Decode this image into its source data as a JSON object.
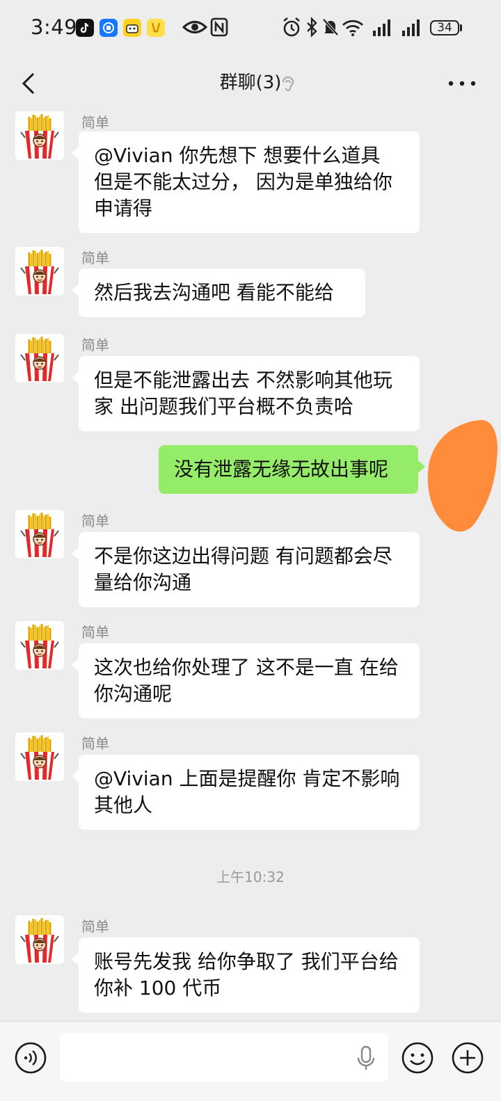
{
  "status_bar": {
    "time": "3:49",
    "battery": "34",
    "icons": [
      "tiktok-icon",
      "app-icon",
      "bilibili-icon",
      "app-icon",
      "eye-icon",
      "nfc-icon",
      "alarm-icon",
      "bluetooth-icon",
      "mute-icon",
      "wifi-icon",
      "signal-icon",
      "signal-icon",
      "battery-icon"
    ]
  },
  "header": {
    "title": "群聊(3)",
    "back_icon": "chevron-left-icon",
    "ear_icon": "ear-icon",
    "more_icon": "more-icon"
  },
  "messages": [
    {
      "sender": "简单",
      "text": "@Vivian  你先想下  想要什么道具 但是不能太过分，   因为是单独给你申请得",
      "direction": "in"
    },
    {
      "sender": "简单",
      "text": "然后我去沟通吧 看能不能给",
      "direction": "in"
    },
    {
      "sender": "简单",
      "text": "但是不能泄露出去  不然影响其他玩家  出问题我们平台概不负责哈",
      "direction": "in"
    },
    {
      "sender": "",
      "text": "没有泄露无缘无故出事呢",
      "direction": "out"
    },
    {
      "sender": "简单",
      "text": "不是你这边出得问题 有问题都会尽量给你沟通",
      "direction": "in"
    },
    {
      "sender": "简单",
      "text": "这次也给你处理了  这不是一直 在给你沟通呢",
      "direction": "in"
    },
    {
      "sender": "简单",
      "text": "@Vivian  上面是提醒你  肯定不影响其他人",
      "direction": "in"
    },
    {
      "sender": "简单",
      "text": "账号先发我  给你争取了 我们平台给你补 100 代币",
      "direction": "in"
    }
  ],
  "timestamp": "上午10:32",
  "input_bar": {
    "value": "",
    "voice_icon": "voice-icon",
    "mic_icon": "mic-icon",
    "emoji_icon": "emoji-icon",
    "plus_icon": "plus-icon"
  },
  "colors": {
    "background": "#ededed",
    "incoming_bubble": "#ffffff",
    "outgoing_bubble": "#95ec69",
    "redaction": "#ff8c3a"
  }
}
